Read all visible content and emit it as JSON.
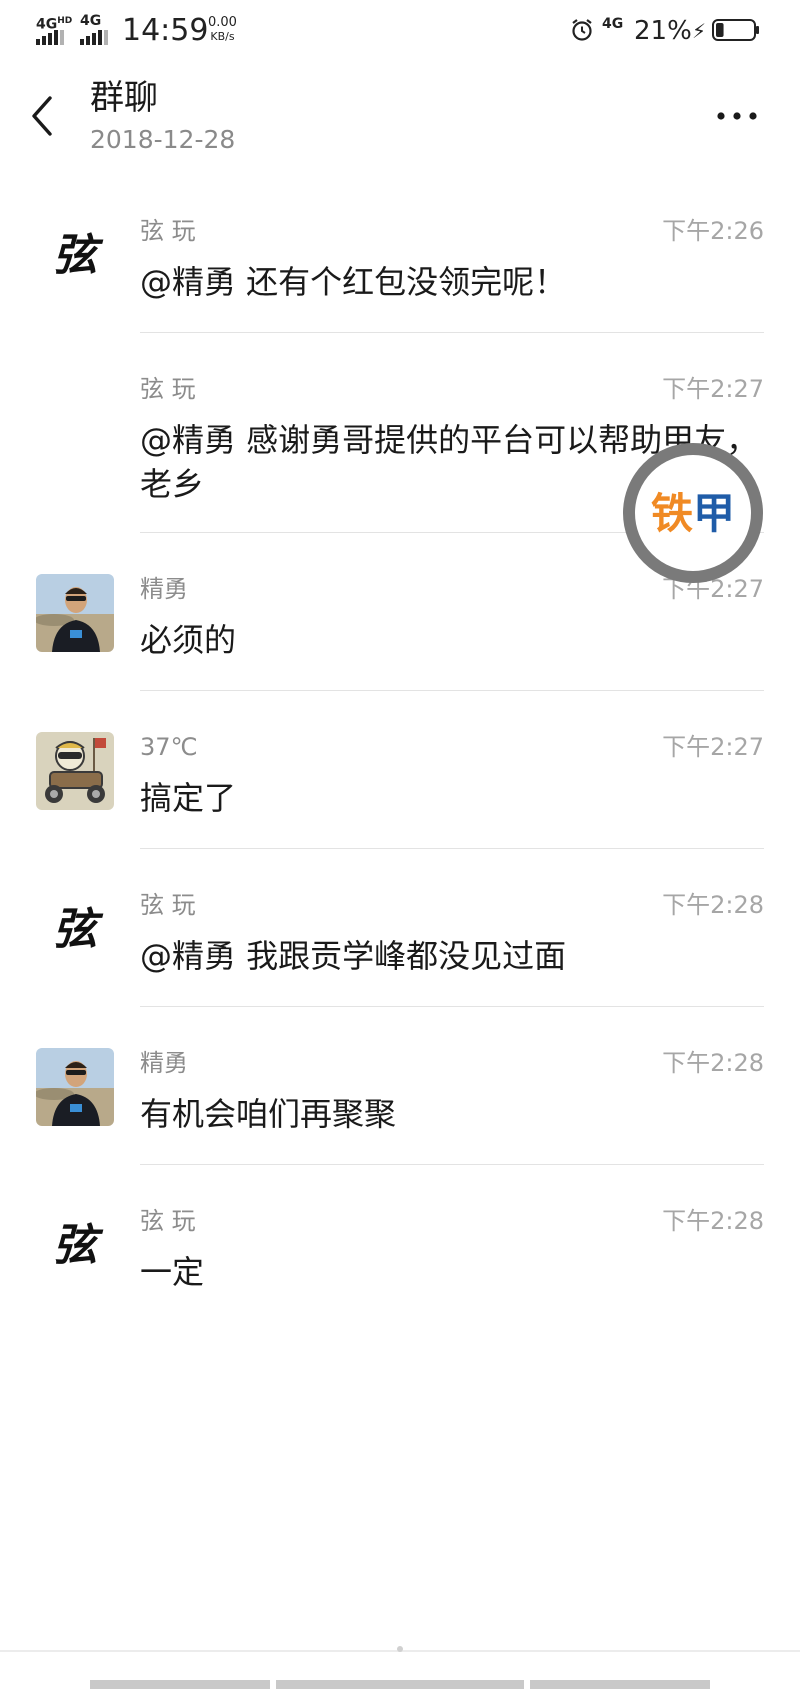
{
  "status_bar": {
    "network_left_1": "4G",
    "network_left_1_sup": "HD",
    "network_left_2": "4G",
    "time": "14:59",
    "speed_value": "0.00",
    "speed_unit": "KB/s",
    "network_right": "4G",
    "battery_percent": "21%",
    "battery_level": 0.21,
    "charging_icon": "bolt-icon",
    "alarm_icon": "alarm-clock-icon"
  },
  "header": {
    "back_icon": "chevron-left-icon",
    "title": "群聊",
    "date": "2018-12-28",
    "more_icon": "ellipsis-icon"
  },
  "messages": [
    {
      "avatar": "xian-calligraphy",
      "sender": "弦 玩",
      "time": "下午2:26",
      "text": "@精勇 还有个红包没领完呢！"
    },
    {
      "avatar": "none",
      "sender": "弦 玩",
      "time": "下午2:27",
      "text": "@精勇 感谢勇哥提供的平台可以帮助甲友，老乡"
    },
    {
      "avatar": "photo-man",
      "sender": "精勇",
      "time": "下午2:27",
      "text": "必须的"
    },
    {
      "avatar": "cartoon-racer",
      "sender": "37℃",
      "time": "下午2:27",
      "text": "搞定了"
    },
    {
      "avatar": "xian-calligraphy",
      "sender": "弦 玩",
      "time": "下午2:28",
      "text": "@精勇 我跟贡学峰都没见过面"
    },
    {
      "avatar": "photo-man",
      "sender": "精勇",
      "time": "下午2:28",
      "text": "有机会咱们再聚聚"
    },
    {
      "avatar": "xian-calligraphy",
      "sender": "弦 玩",
      "time": "下午2:28",
      "text": "一定"
    }
  ],
  "avatar_glyph": "弦",
  "floating_badge": {
    "label": "铁甲",
    "colors": {
      "orange": "#F08A24",
      "blue": "#1F5CA8",
      "ring": "#7A7A7A"
    }
  },
  "colors": {
    "text": "#1a1a1a",
    "secondary": "#8c8c8c",
    "divider": "#e3e3e3"
  }
}
